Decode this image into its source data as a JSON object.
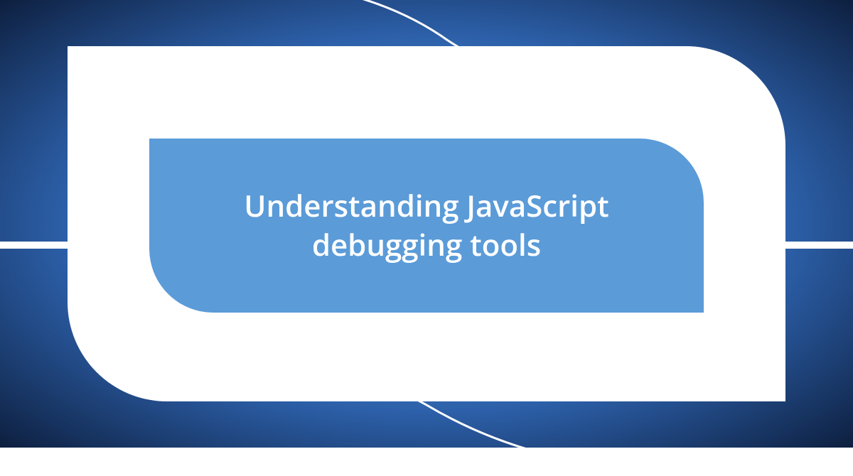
{
  "title": "Understanding JavaScript debugging tools",
  "colors": {
    "background_center": "#6da9e8",
    "background_edge": "#0d1f3f",
    "shape_white": "#ffffff",
    "inner_blue": "#5b9bd8"
  }
}
